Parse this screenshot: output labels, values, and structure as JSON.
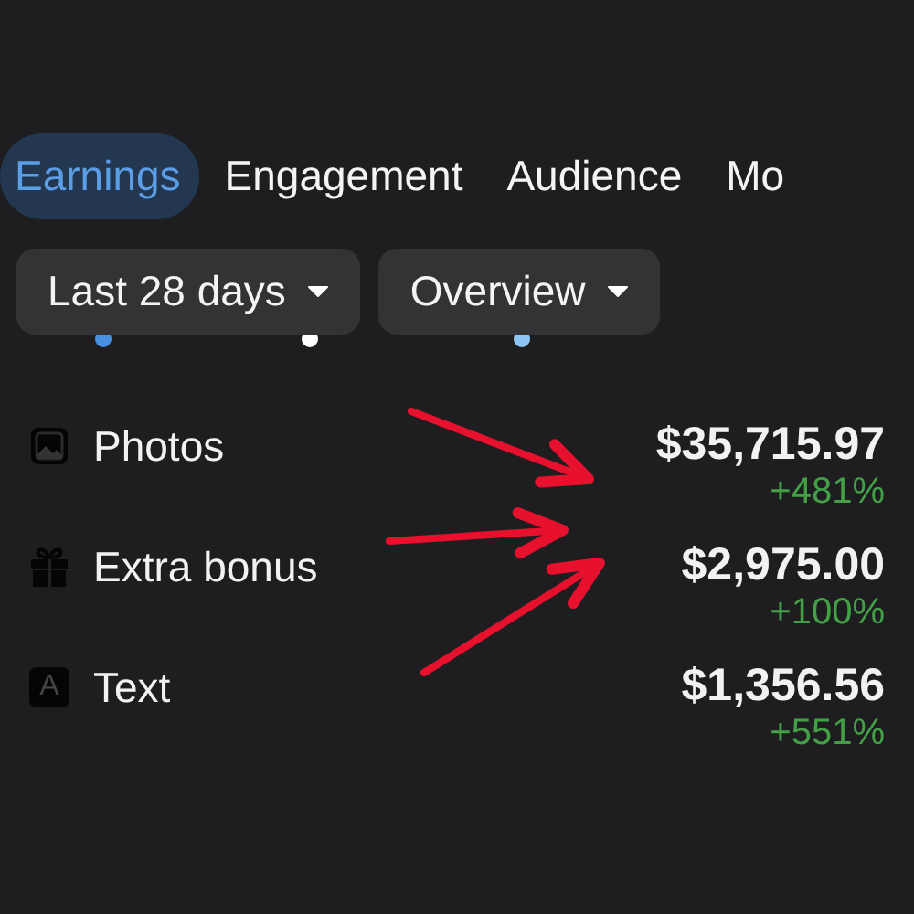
{
  "tabs": [
    {
      "label": "Earnings",
      "selected": true
    },
    {
      "label": "Engagement",
      "selected": false
    },
    {
      "label": "Audience",
      "selected": false
    },
    {
      "label": "Mo",
      "selected": false
    }
  ],
  "filters": [
    {
      "label": "Last 28 days"
    },
    {
      "label": "Overview"
    }
  ],
  "legend": [
    {
      "color": "#4a90e2"
    },
    {
      "color": "#ffffff"
    },
    {
      "color": "#8ec5f5"
    }
  ],
  "rows": [
    {
      "kind": "photo",
      "label": "Photos",
      "amount": "$35,715.97",
      "change": "+481%"
    },
    {
      "kind": "gift",
      "label": "Extra bonus",
      "amount": "$2,975.00",
      "change": "+100%"
    },
    {
      "kind": "letter",
      "glyph": "A",
      "label": "Text",
      "amount": "$1,356.56",
      "change": "+551%"
    }
  ],
  "annotations": [
    {
      "kind": "arrow"
    },
    {
      "kind": "arrow"
    },
    {
      "kind": "arrow"
    }
  ]
}
